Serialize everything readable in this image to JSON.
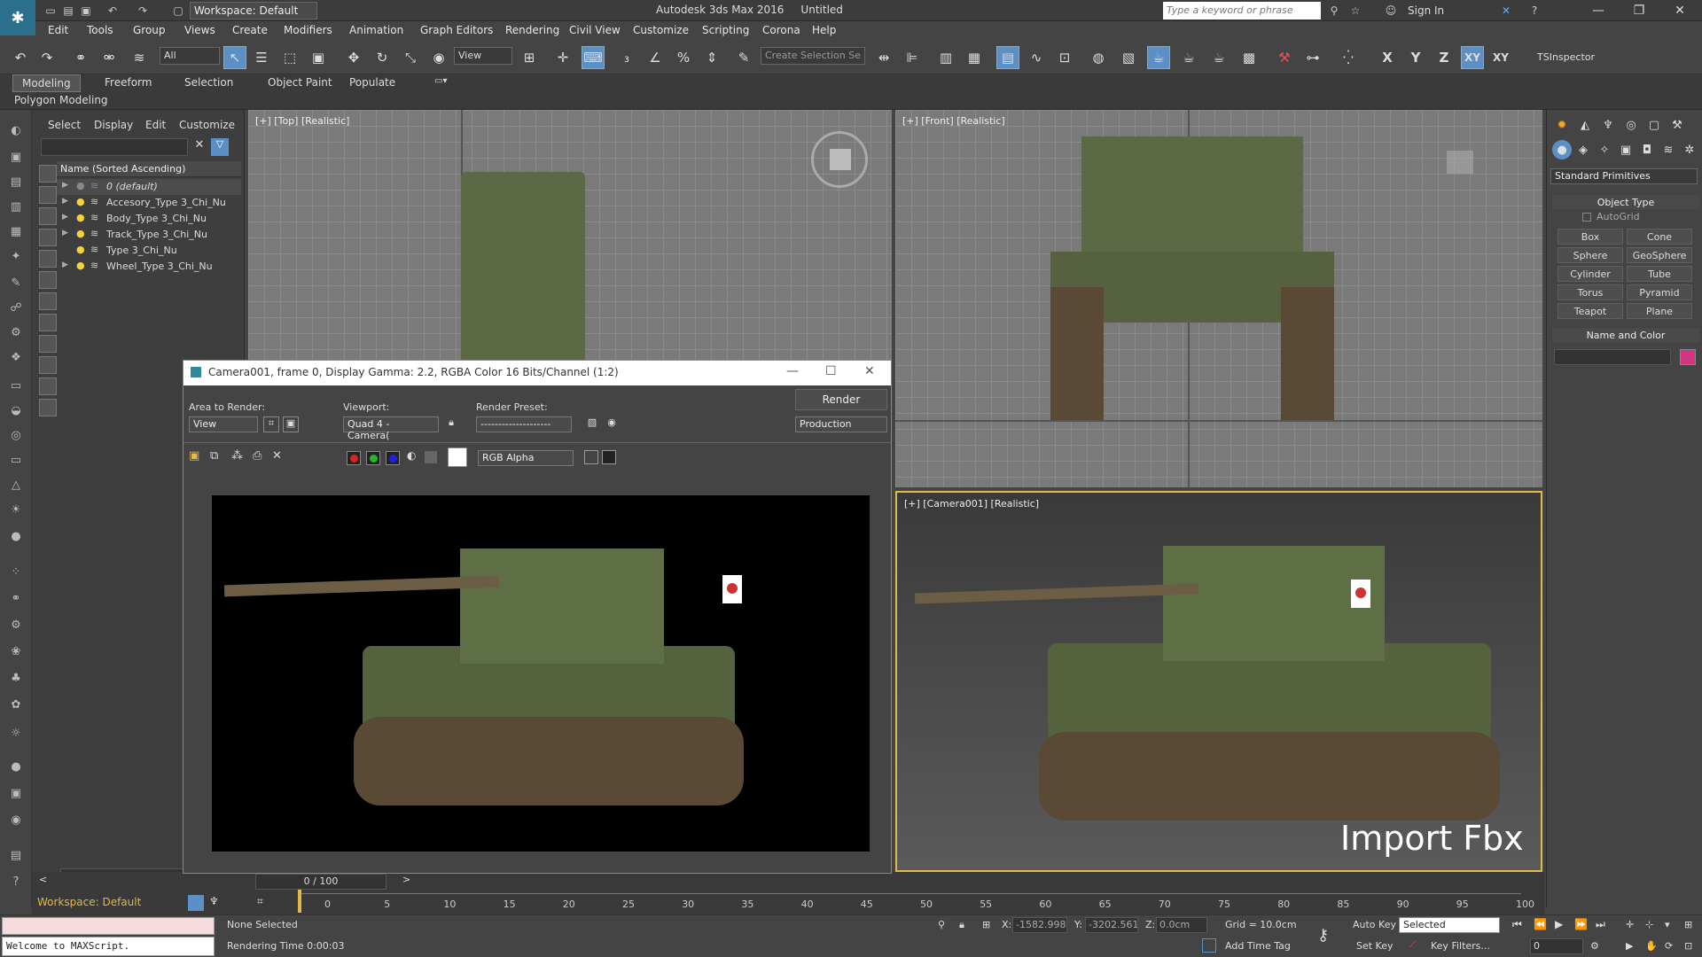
{
  "title_bar": {
    "workspace": "Workspace: Default",
    "app_title": "Autodesk 3ds Max 2016     Untitled",
    "search_placeholder": "Type a keyword or phrase",
    "sign_in": "Sign In"
  },
  "menu": [
    "Edit",
    "Tools",
    "Group",
    "Views",
    "Create",
    "Modifiers",
    "Animation",
    "Graph Editors",
    "Rendering",
    "Civil View",
    "Customize",
    "Scripting",
    "Corona",
    "Help"
  ],
  "toolbar": {
    "selection_filter": "All",
    "ref_coord": "View",
    "named_selection_placeholder": "Create Selection Se",
    "axis_labels": [
      "X",
      "Y",
      "Z",
      "XY",
      "XY"
    ],
    "ts_inspector": "TSInspector"
  },
  "ribbon": {
    "tabs": [
      "Modeling",
      "Freeform",
      "Selection",
      "Object Paint",
      "Populate"
    ],
    "sub_label": "Polygon Modeling"
  },
  "scene_explorer": {
    "menu": [
      "Select",
      "Display",
      "Edit",
      "Customize"
    ],
    "header": "Name (Sorted Ascending)",
    "rows": [
      "0 (default)",
      "Accesory_Type 3_Chi_Nu",
      "Body_Type 3_Chi_Nu",
      "Track_Type 3_Chi_Nu",
      "Type 3_Chi_Nu",
      "Wheel_Type 3_Chi_Nu"
    ],
    "scroll_counter": "0 / 100",
    "workspace_footer": "Workspace: Default"
  },
  "viewports": {
    "top": "[+] [Top] [Realistic]",
    "front": "[+] [Front] [Realistic]",
    "camera": "[+] [Camera001] [Realistic]",
    "overlay_text": "Import Fbx"
  },
  "render_window": {
    "title": "Camera001, frame 0, Display Gamma: 2.2, RGBA Color 16 Bits/Channel (1:2)",
    "area_label": "Area to Render:",
    "area_value": "View",
    "viewport_label": "Viewport:",
    "viewport_value": "Quad 4 - Camera(",
    "preset_label": "Render Preset:",
    "preset_value": "--------------------",
    "render_button": "Render",
    "mode_value": "Production",
    "channel_value": "RGB Alpha"
  },
  "command_panel": {
    "category": "Standard Primitives",
    "object_type_title": "Object Type",
    "autogrid": "AutoGrid",
    "buttons": [
      "Box",
      "Cone",
      "Sphere",
      "GeoSphere",
      "Cylinder",
      "Tube",
      "Torus",
      "Pyramid",
      "Teapot",
      "Plane"
    ],
    "name_color_title": "Name and Color",
    "color_swatch": "#d0357e"
  },
  "timeline": {
    "ticks": [
      "0",
      "5",
      "10",
      "15",
      "20",
      "25",
      "30",
      "35",
      "40",
      "45",
      "50",
      "55",
      "60",
      "65",
      "70",
      "75",
      "80",
      "85",
      "90",
      "95",
      "100"
    ],
    "counter": "0 / 100"
  },
  "status": {
    "maxscript": "Welcome to MAXScript.",
    "selection": "None Selected",
    "render_time": "Rendering Time  0:00:03",
    "x_label": "X:",
    "x_value": "-1582.998c",
    "y_label": "Y:",
    "y_value": "-3202.561",
    "z_label": "Z:",
    "z_value": "0.0cm",
    "grid": "Grid = 10.0cm",
    "add_time_tag": "Add Time Tag",
    "auto_key": "Auto Key",
    "set_key": "Set Key",
    "key_mode": "Selected",
    "key_filters": "Key Filters...",
    "frame": "0"
  }
}
